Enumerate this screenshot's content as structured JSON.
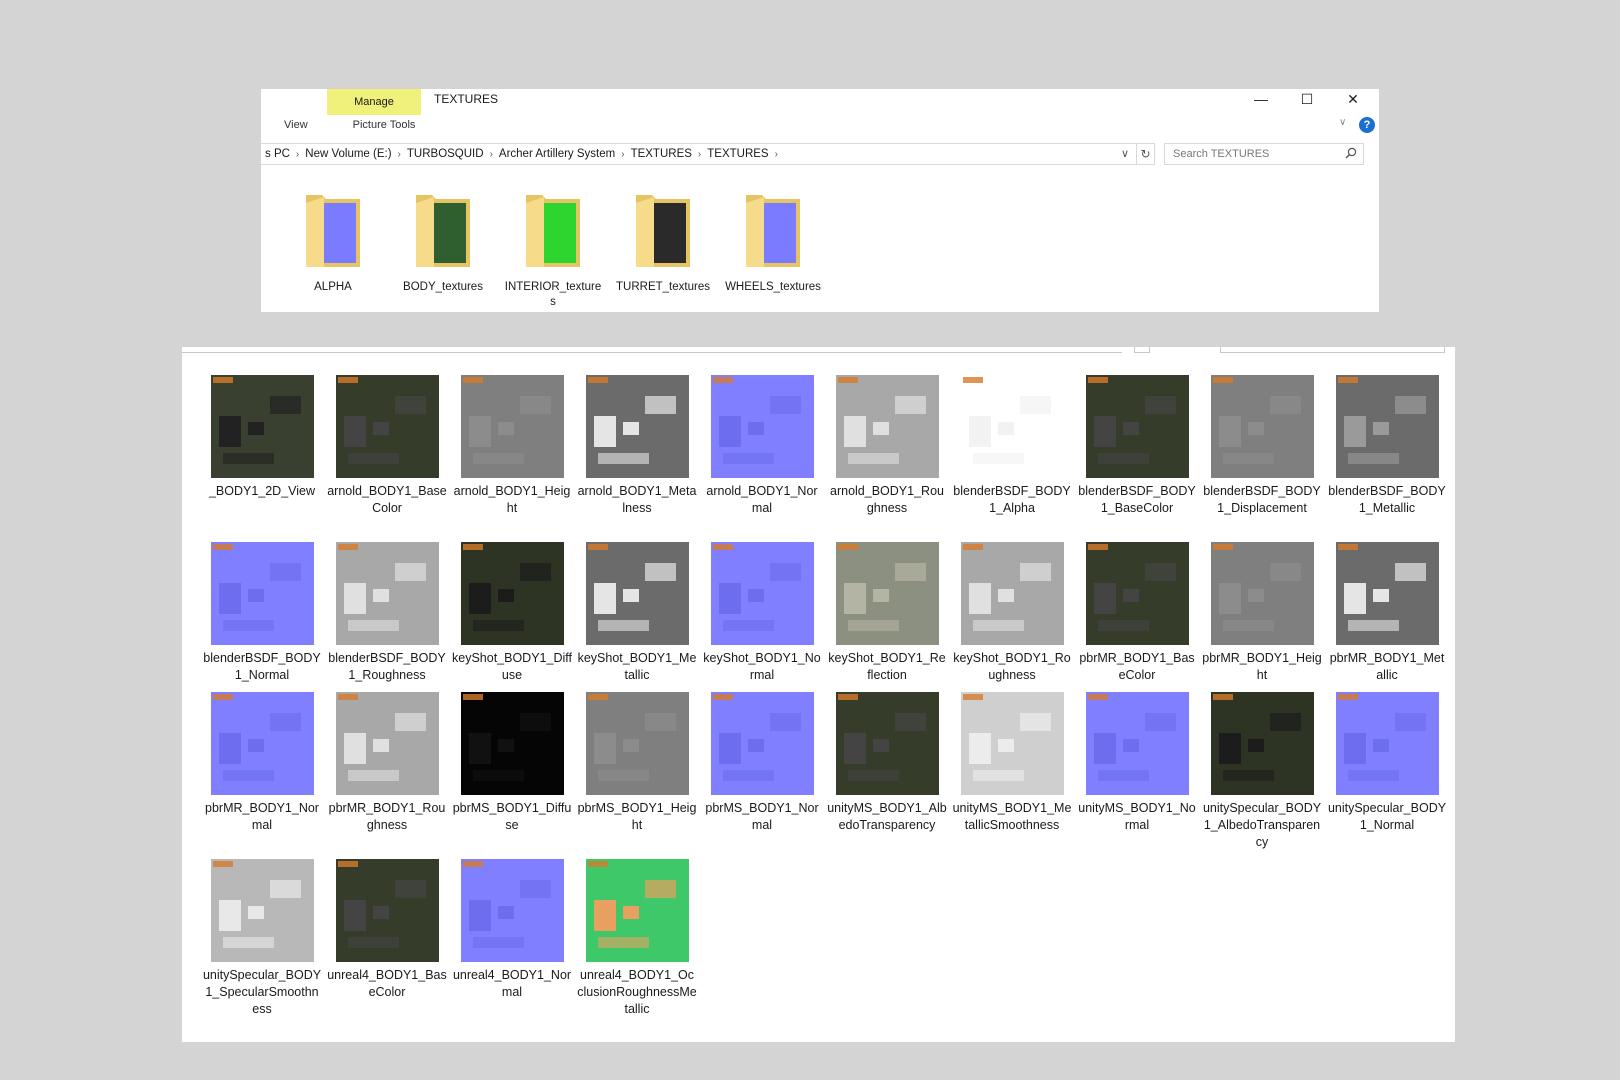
{
  "window_top": {
    "title": "TEXTURES",
    "manage_tab": "Manage",
    "tabs": {
      "view": "View",
      "picture_tools": "Picture Tools"
    },
    "controls": {
      "minimize": "—",
      "maximize": "☐",
      "close": "✕"
    },
    "help": "?",
    "breadcrumb": [
      "s PC",
      "New Volume (E:)",
      "TURBOSQUID",
      "Archer Artillery System",
      "TEXTURES",
      "TEXTURES"
    ],
    "search_placeholder": "Search TEXTURES",
    "folders": [
      {
        "label": "ALPHA",
        "icon": "folder-icon",
        "accent": "#7b7bff"
      },
      {
        "label": "BODY_textures",
        "icon": "folder-icon",
        "accent": "#2f5f2f"
      },
      {
        "label": "INTERIOR_textures",
        "icon": "folder-icon",
        "accent": "#2fd52f"
      },
      {
        "label": "TURRET_textures",
        "icon": "folder-icon",
        "accent": "#2a2a2a"
      },
      {
        "label": "WHEELS_textures",
        "icon": "folder-icon",
        "accent": "#7b7bff"
      }
    ]
  },
  "window_bottom": {
    "files": [
      {
        "label": "_BODY1_2D_View",
        "bg": "#3a4030",
        "mark": "#222"
      },
      {
        "label": "arnold_BODY1_BaseColor",
        "bg": "#363c2a",
        "mark": "#444"
      },
      {
        "label": "arnold_BODY1_Height",
        "bg": "#7f7f7f",
        "mark": "#8c8c8c"
      },
      {
        "label": "arnold_BODY1_Metalness",
        "bg": "#6b6b6b",
        "mark": "#e5e5e5"
      },
      {
        "label": "arnold_BODY1_Normal",
        "bg": "#7f7fff",
        "mark": "#6d6df0"
      },
      {
        "label": "arnold_BODY1_Roughness",
        "bg": "#a8a8a8",
        "mark": "#e0e0e0"
      },
      {
        "label": "blenderBSDF_BODY1_Alpha",
        "bg": "#ffffff",
        "mark": "#f2f2f2"
      },
      {
        "label": "blenderBSDF_BODY1_BaseColor",
        "bg": "#363c2a",
        "mark": "#444"
      },
      {
        "label": "blenderBSDF_BODY1_Displacement",
        "bg": "#7f7f7f",
        "mark": "#8c8c8c"
      },
      {
        "label": "blenderBSDF_BODY1_Metallic",
        "bg": "#6b6b6b",
        "mark": "#9a9a9a"
      },
      {
        "label": "blenderBSDF_BODY1_Normal",
        "bg": "#7f7fff",
        "mark": "#6d6df0"
      },
      {
        "label": "blenderBSDF_BODY1_Roughness",
        "bg": "#a8a8a8",
        "mark": "#e0e0e0"
      },
      {
        "label": "keyShot_BODY1_Diffuse",
        "bg": "#2e3424",
        "mark": "#1c1c1c"
      },
      {
        "label": "keyShot_BODY1_Metallic",
        "bg": "#6b6b6b",
        "mark": "#e5e5e5"
      },
      {
        "label": "keyShot_BODY1_Normal",
        "bg": "#7f7fff",
        "mark": "#6d6df0"
      },
      {
        "label": "keyShot_BODY1_Reflection",
        "bg": "#8c9080",
        "mark": "#b4b4a4"
      },
      {
        "label": "keyShot_BODY1_Roughness",
        "bg": "#a8a8a8",
        "mark": "#e0e0e0"
      },
      {
        "label": "pbrMR_BODY1_BaseColor",
        "bg": "#363c2a",
        "mark": "#444"
      },
      {
        "label": "pbrMR_BODY1_Height",
        "bg": "#7f7f7f",
        "mark": "#8c8c8c"
      },
      {
        "label": "pbrMR_BODY1_Metallic",
        "bg": "#6b6b6b",
        "mark": "#e5e5e5"
      },
      {
        "label": "pbrMR_BODY1_Normal",
        "bg": "#7f7fff",
        "mark": "#6d6df0"
      },
      {
        "label": "pbrMR_BODY1_Roughness",
        "bg": "#a8a8a8",
        "mark": "#e0e0e0"
      },
      {
        "label": "pbrMS_BODY1_Diffuse",
        "bg": "#050505",
        "mark": "#111"
      },
      {
        "label": "pbrMS_BODY1_Height",
        "bg": "#7f7f7f",
        "mark": "#8c8c8c"
      },
      {
        "label": "pbrMS_BODY1_Normal",
        "bg": "#7f7fff",
        "mark": "#6d6df0"
      },
      {
        "label": "unityMS_BODY1_AlbedoTransparency",
        "bg": "#363c2a",
        "mark": "#444"
      },
      {
        "label": "unityMS_BODY1_MetallicSmoothness",
        "bg": "#cfcfcf",
        "mark": "#ececec"
      },
      {
        "label": "unityMS_BODY1_Normal",
        "bg": "#7f7fff",
        "mark": "#6d6df0"
      },
      {
        "label": "unitySpecular_BODY1_AlbedoTransparency",
        "bg": "#2e3424",
        "mark": "#1c1c1c"
      },
      {
        "label": "unitySpecular_BODY1_Normal",
        "bg": "#7f7fff",
        "mark": "#6d6df0"
      },
      {
        "label": "unitySpecular_BODY1_SpecularSmoothness",
        "bg": "#b8b8b8",
        "mark": "#e8e8e8"
      },
      {
        "label": "unreal4_BODY1_BaseColor",
        "bg": "#363c2a",
        "mark": "#444"
      },
      {
        "label": "unreal4_BODY1_Normal",
        "bg": "#7f7fff",
        "mark": "#6d6df0"
      },
      {
        "label": "unreal4_BODY1_OcclusionRoughnessMetallic",
        "bg": "#3fc86a",
        "mark": "#e8a060"
      }
    ]
  }
}
